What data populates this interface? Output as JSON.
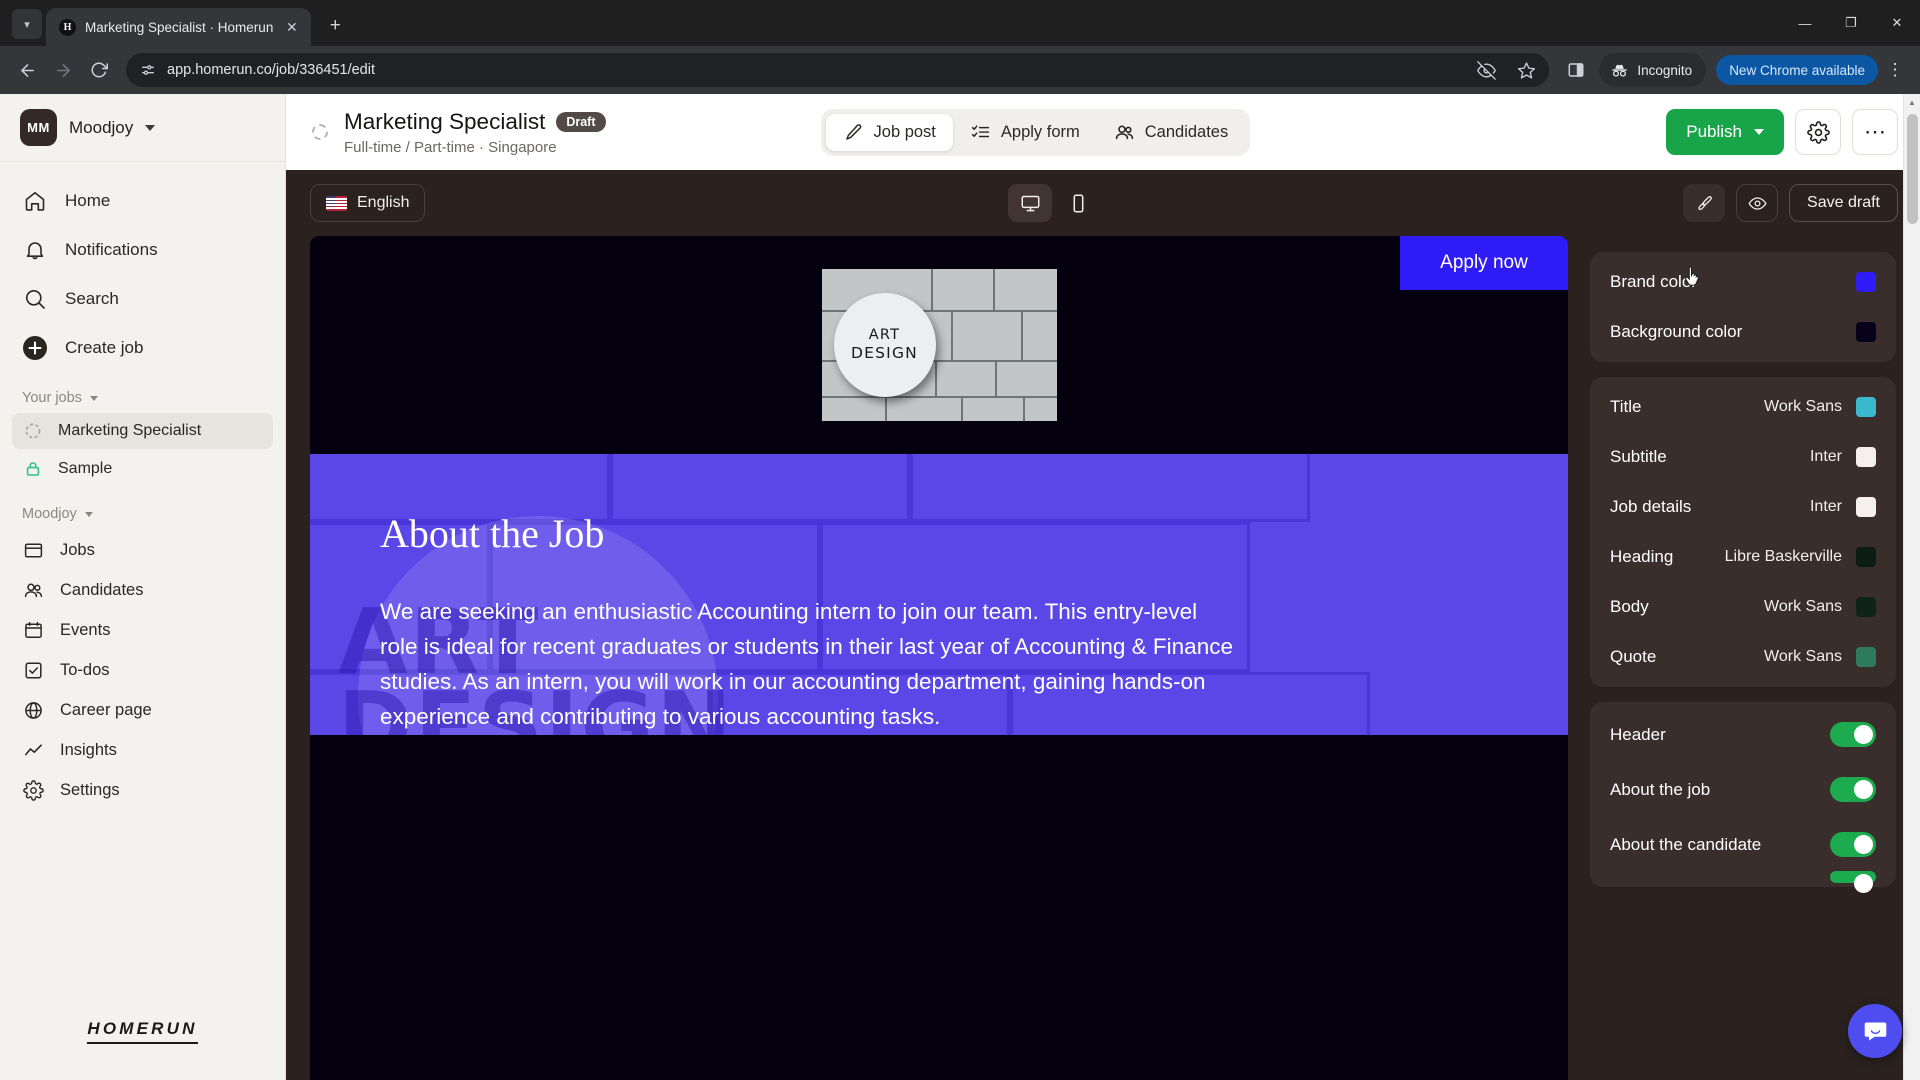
{
  "browser": {
    "tab": {
      "title": "Marketing Specialist · Homerun",
      "favicon_letter": "H",
      "close_icon": "close-icon"
    },
    "newtab_label": "+",
    "window_controls": {
      "minimize": "—",
      "maximize": "❐",
      "close": "✕"
    },
    "nav": {
      "back": "←",
      "forward": "→",
      "reload": "⟳"
    },
    "omnibox": {
      "url": "app.homerun.co/job/336451/edit",
      "site_icon": "site-settings-icon"
    },
    "omni_actions": {
      "tracking": "eye-off-icon",
      "bookmark": "star-icon"
    },
    "side_panel": "side-panel-icon",
    "incognito_label": "Incognito",
    "update_label": "New Chrome available",
    "menu": "kebab-menu-icon"
  },
  "sidebar": {
    "org": {
      "initials": "MM",
      "name": "Moodjoy"
    },
    "nav": [
      {
        "label": "Home",
        "icon": "home-icon"
      },
      {
        "label": "Notifications",
        "icon": "bell-icon"
      },
      {
        "label": "Search",
        "icon": "search-icon"
      },
      {
        "label": "Create job",
        "icon": "plus-circle-icon"
      }
    ],
    "your_jobs": {
      "label": "Your jobs",
      "items": [
        {
          "label": "Marketing Specialist",
          "icon": "draft-ring-icon",
          "active": true
        },
        {
          "label": "Sample",
          "icon": "lock-icon",
          "active": false
        }
      ]
    },
    "workspace": {
      "label": "Moodjoy",
      "items": [
        {
          "label": "Jobs",
          "icon": "jobs-icon"
        },
        {
          "label": "Candidates",
          "icon": "people-icon"
        },
        {
          "label": "Events",
          "icon": "calendar-icon"
        },
        {
          "label": "To-dos",
          "icon": "checkbox-icon"
        },
        {
          "label": "Career page",
          "icon": "globe-icon"
        },
        {
          "label": "Insights",
          "icon": "chart-icon"
        },
        {
          "label": "Settings",
          "icon": "gear-icon"
        }
      ]
    },
    "footer_logo": "HOMERUN"
  },
  "job_header": {
    "title": "Marketing Specialist",
    "status_badge": "Draft",
    "subtitle": "Full-time / Part-time · Singapore",
    "tabs": [
      {
        "label": "Job post",
        "icon": "pencil-icon",
        "active": true
      },
      {
        "label": "Apply form",
        "icon": "checklist-icon",
        "active": false
      },
      {
        "label": "Candidates",
        "icon": "people-icon",
        "active": false
      }
    ],
    "publish_label": "Publish",
    "settings_icon": "gear-icon",
    "more_icon": "ellipsis-icon"
  },
  "editor_toolbar": {
    "language": "English",
    "language_flag": "us-flag-icon",
    "devices": [
      {
        "name": "desktop-view",
        "icon": "monitor-icon",
        "active": true
      },
      {
        "name": "mobile-view",
        "icon": "phone-icon",
        "active": false
      }
    ],
    "brush_icon": "brush-icon",
    "preview_icon": "eye-icon",
    "save_label": "Save draft"
  },
  "preview": {
    "apply_button": "Apply now",
    "hero_logo_line1": "ART",
    "hero_logo_line2": "DESIGN",
    "about_heading": "About the Job",
    "about_body": "We are seeking an enthusiastic Accounting intern to join our team. This entry-level role is ideal for recent graduates or students in their last year of Accounting & Finance studies. As an intern, you will work in our accounting department, gaining hands-on experience and contributing to various accounting tasks.",
    "bg_color": "#5b46e8",
    "hero_bg": "#05000f",
    "apply_color": "#2f1bf5"
  },
  "right_panel": {
    "colors": [
      {
        "label": "Brand color",
        "value": "#2f1bf5"
      },
      {
        "label": "Background color",
        "value": "#07021a"
      }
    ],
    "typography": [
      {
        "label": "Title",
        "font": "Work Sans",
        "color": "#3ab8cc"
      },
      {
        "label": "Subtitle",
        "font": "Inter",
        "color": "#f5f0ed"
      },
      {
        "label": "Job details",
        "font": "Inter",
        "color": "#f5f0ed"
      },
      {
        "label": "Heading",
        "font": "Libre Baskerville",
        "color": "#0d1c14"
      },
      {
        "label": "Body",
        "font": "Work Sans",
        "color": "#0f2419"
      },
      {
        "label": "Quote",
        "font": "Work Sans",
        "color": "#2e7a5e"
      }
    ],
    "sections": [
      {
        "label": "Header",
        "enabled": true
      },
      {
        "label": "About the job",
        "enabled": true
      },
      {
        "label": "About the candidate",
        "enabled": true
      }
    ],
    "chat_icon": "chat-bubble-icon"
  }
}
